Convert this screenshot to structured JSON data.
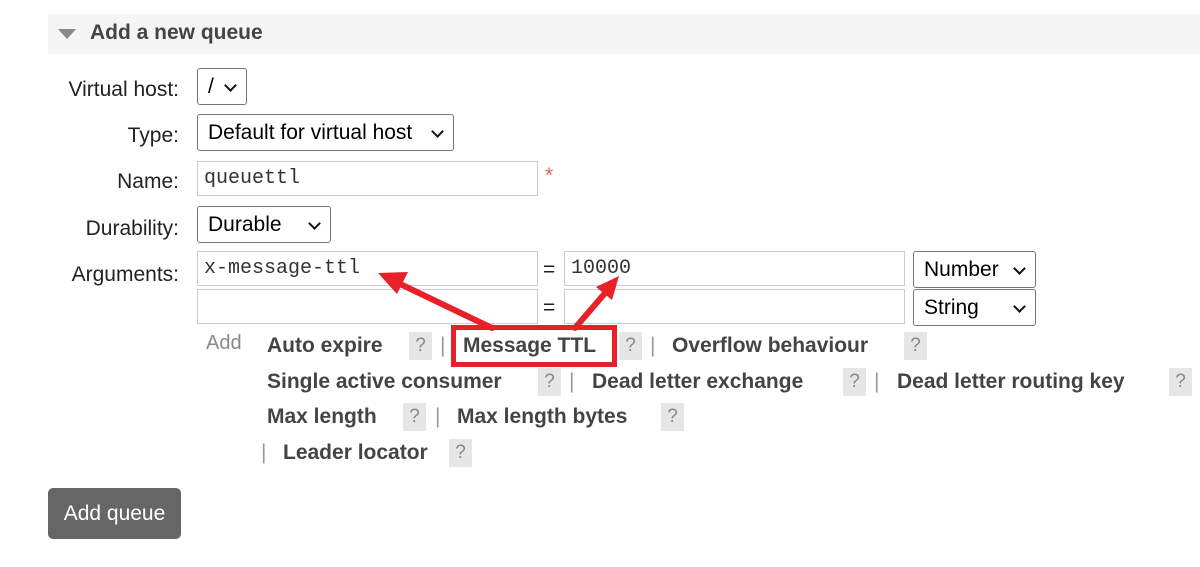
{
  "section": {
    "title": "Add a new queue"
  },
  "form": {
    "virtual_host": {
      "label": "Virtual host:",
      "value": "/"
    },
    "type": {
      "label": "Type:",
      "value": "Default for virtual host"
    },
    "name": {
      "label": "Name:",
      "value": "queuettl",
      "required_mark": "*"
    },
    "durability": {
      "label": "Durability:",
      "value": "Durable"
    },
    "arguments": {
      "label": "Arguments:",
      "equals": "=",
      "rows": [
        {
          "key": "x-message-ttl",
          "value": "10000",
          "type": "Number"
        },
        {
          "key": "",
          "value": "",
          "type": "String"
        }
      ]
    },
    "add_label": "Add",
    "shortcuts": {
      "auto_expire": "Auto expire",
      "message_ttl": "Message TTL",
      "overflow_behaviour": "Overflow behaviour",
      "single_active_consumer": "Single active consumer",
      "dead_letter_exchange": "Dead letter exchange",
      "dead_letter_routing_key": "Dead letter routing key",
      "max_length": "Max length",
      "max_length_bytes": "Max length bytes",
      "leader_locator": "Leader locator"
    },
    "help_mark": "?",
    "separator": "|"
  },
  "submit": {
    "label": "Add queue"
  },
  "colors": {
    "annotation": "#e8202a",
    "button_bg": "#666666",
    "header_bg": "#f5f5f5"
  }
}
